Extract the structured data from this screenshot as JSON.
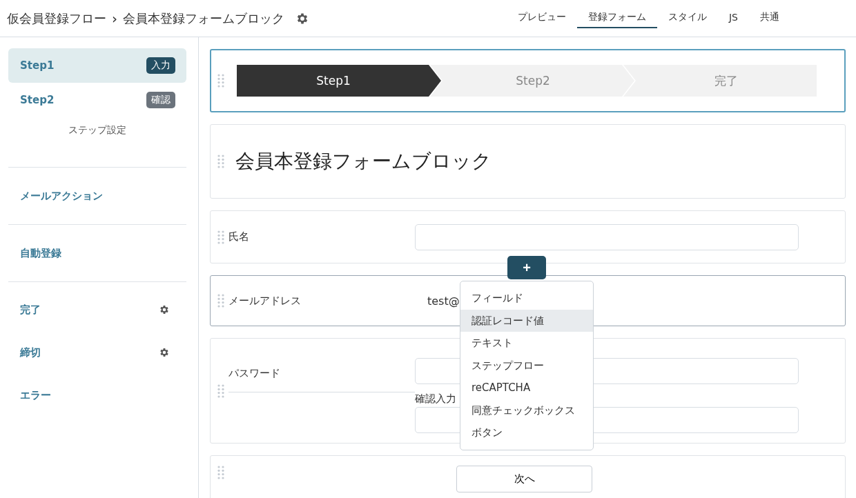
{
  "breadcrumb": {
    "parent": "仮会員登録フロー",
    "separator": "›",
    "current": "会員本登録フォームブロック"
  },
  "tabs": [
    {
      "label": "プレビュー",
      "selected": false
    },
    {
      "label": "登録フォーム",
      "selected": true
    },
    {
      "label": "スタイル",
      "selected": false
    },
    {
      "label": "JS",
      "selected": false
    },
    {
      "label": "共通",
      "selected": false
    }
  ],
  "sidebar": {
    "steps": [
      {
        "label": "Step1",
        "badge": "入力",
        "color": "#234e62",
        "selected": true
      },
      {
        "label": "Step2",
        "badge": "確認",
        "color": "#6b737c",
        "selected": false
      }
    ],
    "step_settings": "ステップ設定",
    "sections": [
      {
        "label": "メールアクション"
      },
      {
        "label": "自動登録"
      }
    ],
    "endings": [
      {
        "label": "完了",
        "settings": true
      },
      {
        "label": "締切",
        "settings": true
      },
      {
        "label": "エラー",
        "settings": false
      }
    ]
  },
  "blocks": [
    {
      "kind": "steps",
      "selected": true,
      "hovered": false,
      "steps": [
        {
          "label": "Step1",
          "selected": true
        },
        {
          "label": "Step2",
          "selected": false
        },
        {
          "label": "完了",
          "selected": false
        }
      ]
    },
    {
      "kind": "heading",
      "selected": false,
      "hovered": false,
      "text": "会員本登録フォームブロック"
    },
    {
      "kind": "field",
      "selected": false,
      "hovered": false,
      "label": "氏名"
    },
    {
      "kind": "field",
      "selected": false,
      "hovered": true,
      "label": "メールアドレス",
      "value": "test@",
      "add_menu": {
        "button": "+",
        "items": [
          {
            "label": "フィールド",
            "highlighted": false
          },
          {
            "label": "認証レコード値",
            "highlighted": true
          },
          {
            "label": "テキスト",
            "highlighted": false
          },
          {
            "label": "ステップフロー",
            "highlighted": false
          },
          {
            "label": "reCAPTCHA",
            "highlighted": false
          },
          {
            "label": "同意チェックボックス",
            "highlighted": false
          },
          {
            "label": "ボタン",
            "highlighted": false
          }
        ]
      }
    },
    {
      "kind": "password",
      "selected": false,
      "hovered": false,
      "label": "パスワード",
      "confirm_label": "確認入力"
    },
    {
      "kind": "button",
      "selected": false,
      "hovered": false,
      "text": "次へ"
    }
  ]
}
